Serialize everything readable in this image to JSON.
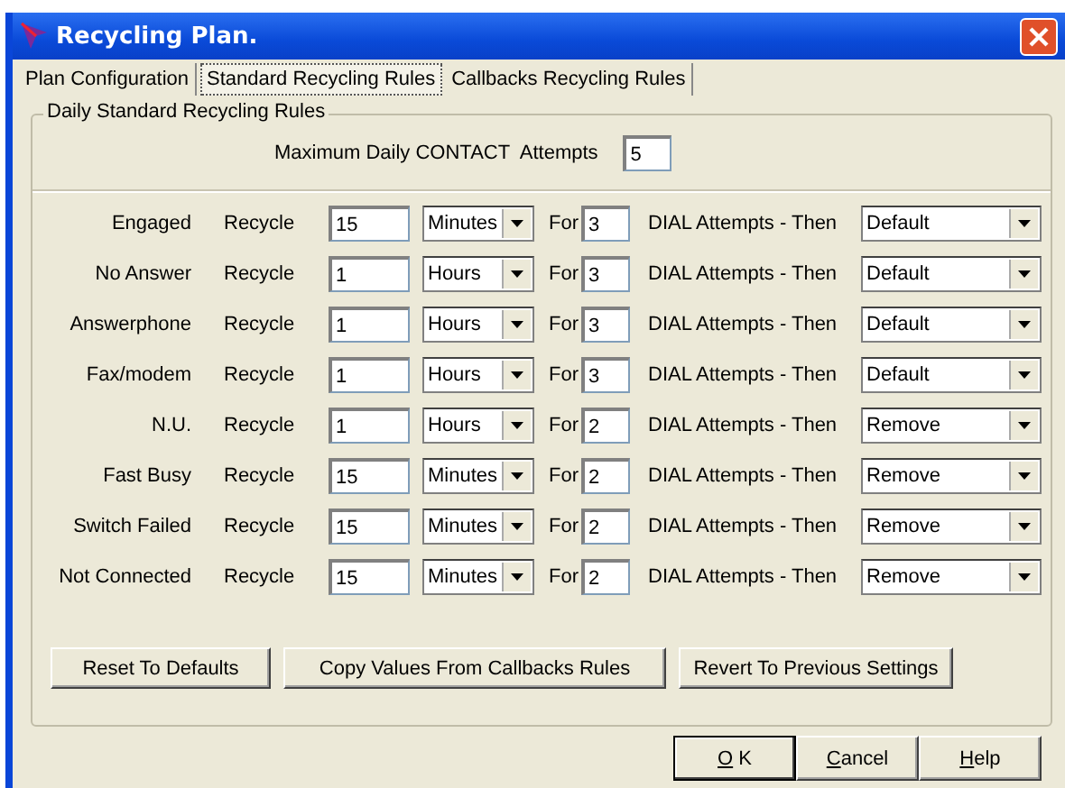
{
  "window": {
    "title": "Recycling Plan."
  },
  "tabs": [
    {
      "label": "Plan Configuration",
      "selected": false
    },
    {
      "label": "Standard Recycling Rules",
      "selected": true
    },
    {
      "label": "Callbacks Recycling Rules",
      "selected": false
    }
  ],
  "group": {
    "title": "Daily Standard Recycling Rules",
    "max_label": "Maximum Daily CONTACT  Attempts",
    "max_value": "5"
  },
  "rules": [
    {
      "name": "Engaged",
      "recycle": "Recycle",
      "interval": "15",
      "unit": "Minutes",
      "for": "For",
      "attempts": "3",
      "then": "DIAL Attempts - Then",
      "action": "Default"
    },
    {
      "name": "No Answer",
      "recycle": "Recycle",
      "interval": "1",
      "unit": "Hours",
      "for": "For",
      "attempts": "3",
      "then": "DIAL Attempts - Then",
      "action": "Default"
    },
    {
      "name": "Answerphone",
      "recycle": "Recycle",
      "interval": "1",
      "unit": "Hours",
      "for": "For",
      "attempts": "3",
      "then": "DIAL Attempts - Then",
      "action": "Default"
    },
    {
      "name": "Fax/modem",
      "recycle": "Recycle",
      "interval": "1",
      "unit": "Hours",
      "for": "For",
      "attempts": "3",
      "then": "DIAL Attempts - Then",
      "action": "Default"
    },
    {
      "name": "N.U.",
      "recycle": "Recycle",
      "interval": "1",
      "unit": "Hours",
      "for": "For",
      "attempts": "2",
      "then": "DIAL Attempts - Then",
      "action": "Remove"
    },
    {
      "name": "Fast Busy",
      "recycle": "Recycle",
      "interval": "15",
      "unit": "Minutes",
      "for": "For",
      "attempts": "2",
      "then": "DIAL Attempts - Then",
      "action": "Remove"
    },
    {
      "name": "Switch Failed",
      "recycle": "Recycle",
      "interval": "15",
      "unit": "Minutes",
      "for": "For",
      "attempts": "2",
      "then": "DIAL Attempts - Then",
      "action": "Remove"
    },
    {
      "name": "Not Connected",
      "recycle": "Recycle",
      "interval": "15",
      "unit": "Minutes",
      "for": "For",
      "attempts": "2",
      "then": "DIAL Attempts - Then",
      "action": "Remove"
    }
  ],
  "group_buttons": [
    "Reset To Defaults",
    "Copy Values From Callbacks Rules",
    "Revert To Previous Settings"
  ],
  "dialog_buttons": [
    {
      "mnemonic": "O",
      "rest": " K",
      "default": true
    },
    {
      "mnemonic": "C",
      "rest": "ancel",
      "default": false
    },
    {
      "mnemonic": "H",
      "rest": "elp",
      "default": false
    }
  ]
}
